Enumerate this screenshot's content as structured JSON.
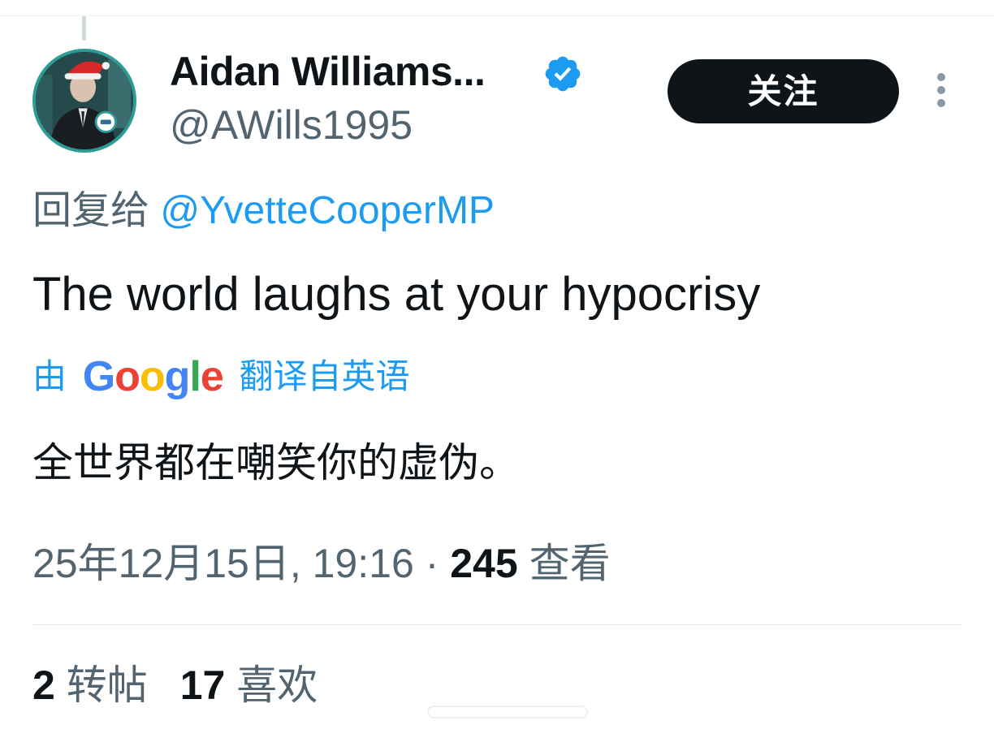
{
  "tweet": {
    "author": {
      "display_name": "Aidan Williams...",
      "handle": "@AWills1995",
      "verified": true
    },
    "follow_label": "关注",
    "reply_prefix": "回复给",
    "reply_to": "@YvetteCooperMP",
    "text": "The world laughs at your hypocrisy",
    "translation": {
      "prefix": "由",
      "provider_letters": [
        "G",
        "o",
        "o",
        "g",
        "l",
        "e"
      ],
      "suffix": "翻译自英语",
      "text": "全世界都在嘲笑你的虚伪。"
    },
    "timestamp": "25年12月15日, 19:16",
    "separator": "·",
    "views_count": "245",
    "views_label": "查看",
    "stats": {
      "retweets_count": "2",
      "retweets_label": "转帖",
      "likes_count": "17",
      "likes_label": "喜欢"
    }
  },
  "colors": {
    "text": "#0f1419",
    "secondary": "#536471",
    "link": "#1d9bf0",
    "follow_bg": "#0f1419",
    "verified": "#1d9bf0"
  },
  "icons": {
    "verified": "verified-badge-icon",
    "more": "more-vertical-icon"
  }
}
